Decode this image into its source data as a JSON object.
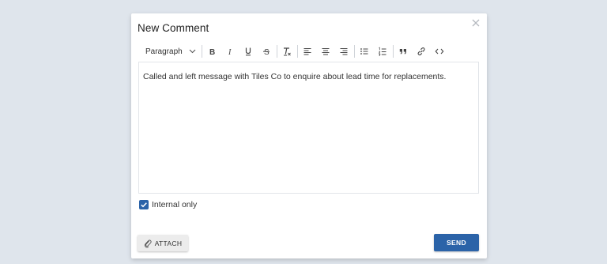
{
  "dialog": {
    "title": "New Comment",
    "close_icon": "close-icon"
  },
  "toolbar": {
    "block_format": "Paragraph",
    "buttons": [
      {
        "name": "bold-button",
        "icon": "bold-icon"
      },
      {
        "name": "italic-button",
        "icon": "italic-icon"
      },
      {
        "name": "underline-button",
        "icon": "underline-icon"
      },
      {
        "name": "strikethrough-button",
        "icon": "strikethrough-icon"
      },
      {
        "name": "clear-formatting-button",
        "icon": "clear-formatting-icon"
      },
      {
        "name": "align-left-button",
        "icon": "align-left-icon"
      },
      {
        "name": "align-center-button",
        "icon": "align-center-icon"
      },
      {
        "name": "align-right-button",
        "icon": "align-right-icon"
      },
      {
        "name": "bulleted-list-button",
        "icon": "bulleted-list-icon"
      },
      {
        "name": "numbered-list-button",
        "icon": "numbered-list-icon"
      },
      {
        "name": "blockquote-button",
        "icon": "blockquote-icon"
      },
      {
        "name": "link-button",
        "icon": "link-icon"
      },
      {
        "name": "code-button",
        "icon": "code-icon"
      }
    ]
  },
  "editor": {
    "content": "Called and left message with Tiles Co to enquire about lead time for replacements."
  },
  "internal_only": {
    "label": "Internal only",
    "checked": true
  },
  "actions": {
    "attach_label": "ATTACH",
    "attach_icon": "paperclip-icon",
    "send_label": "SEND"
  },
  "colors": {
    "accent": "#2b63a8",
    "background": "#dfe5ec"
  }
}
